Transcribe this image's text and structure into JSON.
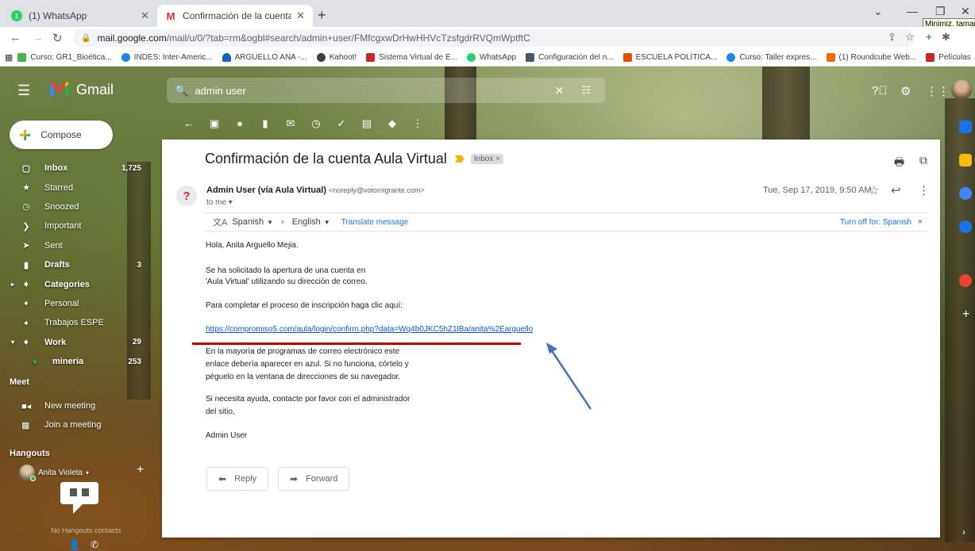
{
  "browser": {
    "tabs": [
      {
        "title": "(1) WhatsApp",
        "favicon": "1"
      },
      {
        "title": "Confirmación de la cuenta Aula \\"
      }
    ],
    "tooltip": "Minimiz. tamaño",
    "url_host": "mail.google.com",
    "url_path": "/mail/u/0/?tab=rm&ogbl#search/admin+user/FMfcgxwDrHwHHVcTzsfgdrRVQmWptftC",
    "bookmarks": [
      {
        "label": "Curso: GR1_Bioética...",
        "color": "#4caf50"
      },
      {
        "label": "INDES: Inter-Americ...",
        "color": "#1e88e5"
      },
      {
        "label": "ARGUELLO ANA -...",
        "color": "#1565c0"
      },
      {
        "label": "Kahoot!",
        "color": "#3c4043"
      },
      {
        "label": "Sistema Virtual de E...",
        "color": "#c62828"
      },
      {
        "label": "WhatsApp",
        "color": "#25d366"
      },
      {
        "label": "Configuración del n...",
        "color": "#455a64"
      },
      {
        "label": "ESCUELA POLÍTICA...",
        "color": "#e65100"
      },
      {
        "label": "Curso: Taller expres...",
        "color": "#1e88e5"
      },
      {
        "label": "(1) Roundcube Web...",
        "color": "#ef6c00"
      },
      {
        "label": "Películas",
        "color": "#c62828"
      }
    ]
  },
  "gmail": {
    "brand": "Gmail",
    "search_value": "admin user",
    "compose_label": "Compose",
    "nav": [
      {
        "label": "Inbox",
        "count": "1,725",
        "bold": true,
        "icon": "inbox-icon"
      },
      {
        "label": "Starred",
        "count": "",
        "bold": false,
        "icon": "star-icon"
      },
      {
        "label": "Snoozed",
        "count": "",
        "bold": false,
        "icon": "clock-icon"
      },
      {
        "label": "Important",
        "count": "",
        "bold": false,
        "icon": "important-icon"
      },
      {
        "label": "Sent",
        "count": "",
        "bold": false,
        "icon": "send-icon"
      },
      {
        "label": "Drafts",
        "count": "3",
        "bold": true,
        "icon": "draft-icon"
      },
      {
        "label": "Categories",
        "count": "",
        "bold": true,
        "icon": "label-icon"
      },
      {
        "label": "Personal",
        "count": "",
        "bold": false,
        "icon": "label-icon"
      },
      {
        "label": "Trabajos ESPE",
        "count": "",
        "bold": false,
        "icon": "label-icon"
      },
      {
        "label": "Work",
        "count": "29",
        "bold": true,
        "icon": "label-icon"
      },
      {
        "label": "mineria",
        "count": "253",
        "bold": true,
        "icon": "label-green-icon"
      }
    ],
    "meet_header": "Meet",
    "meet_items": [
      "New meeting",
      "Join a meeting"
    ],
    "hangouts_header": "Hangouts",
    "hangouts_user": "Anita Violeta",
    "hangouts_empty": "No Hangouts contacts"
  },
  "email": {
    "subject": "Confirmación de la cuenta Aula Virtual",
    "inbox_chip": "Inbox ×",
    "sender_name": "Admin User (vía Aula Virtual)",
    "sender_email": "<noreply@votomigrante.com>",
    "to": "to me ▾",
    "date": "Tue, Sep 17, 2019, 9:50 AM",
    "translate": {
      "from": "Spanish",
      "to": "English",
      "link": "Translate message",
      "turn_off": "Turn off for: Spanish"
    },
    "body": [
      "Hola, Anita Arguello Mejia.",
      "Se ha solicitado la apertura de una cuenta en",
      "'Aula Virtual' utilizando su dirección de correo.",
      "Para completar el proceso de inscripción haga clic aquí:",
      "En la mayoría de programas de correo electrónico este",
      "enlace debería aparecer en azul. Si no funciona, córtelo y",
      "péguelo en la ventana de direcciones de su navegador.",
      "Si necesita ayuda, contacte por favor con el administrador",
      "del sitio,",
      "Admin User"
    ],
    "confirm_link": "https://compromiso5.com/aula/login/confirm.php?data=Wq4b0JKC5hZ1lBa/anita%2Earguello",
    "reply_label": "Reply",
    "forward_label": "Forward"
  }
}
